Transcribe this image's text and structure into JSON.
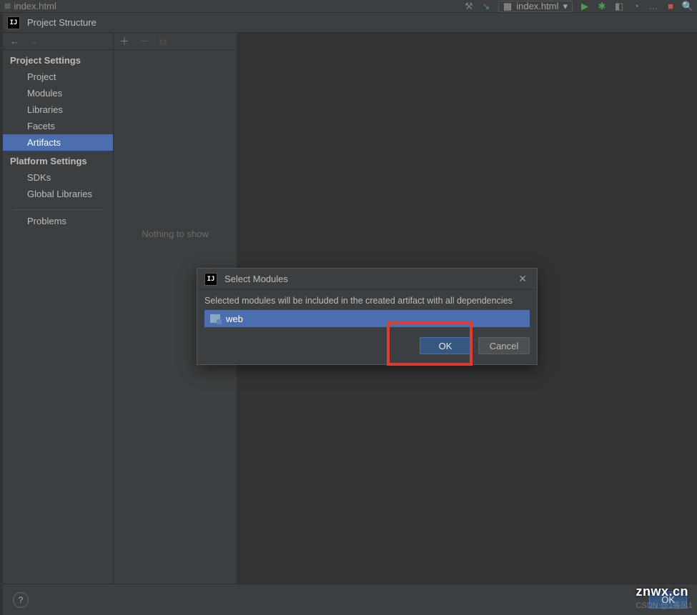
{
  "ide": {
    "tab_label": "index.html",
    "dropdown_label": "index.html"
  },
  "window": {
    "title": "Project Structure"
  },
  "sidebar": {
    "section1": "Project Settings",
    "items1": [
      "Project",
      "Modules",
      "Libraries",
      "Facets",
      "Artifacts"
    ],
    "section2": "Platform Settings",
    "items2": [
      "SDKs",
      "Global Libraries"
    ],
    "problems": "Problems"
  },
  "mid": {
    "empty_text": "Nothing to show"
  },
  "modal": {
    "title": "Select Modules",
    "description": "Selected modules will be included in the created artifact with all dependencies",
    "item": "web",
    "ok": "OK",
    "cancel": "Cancel"
  },
  "footer": {
    "ok": "OK"
  },
  "watermark": "znwx.cn",
  "csdn": "CSDN @1等风1"
}
